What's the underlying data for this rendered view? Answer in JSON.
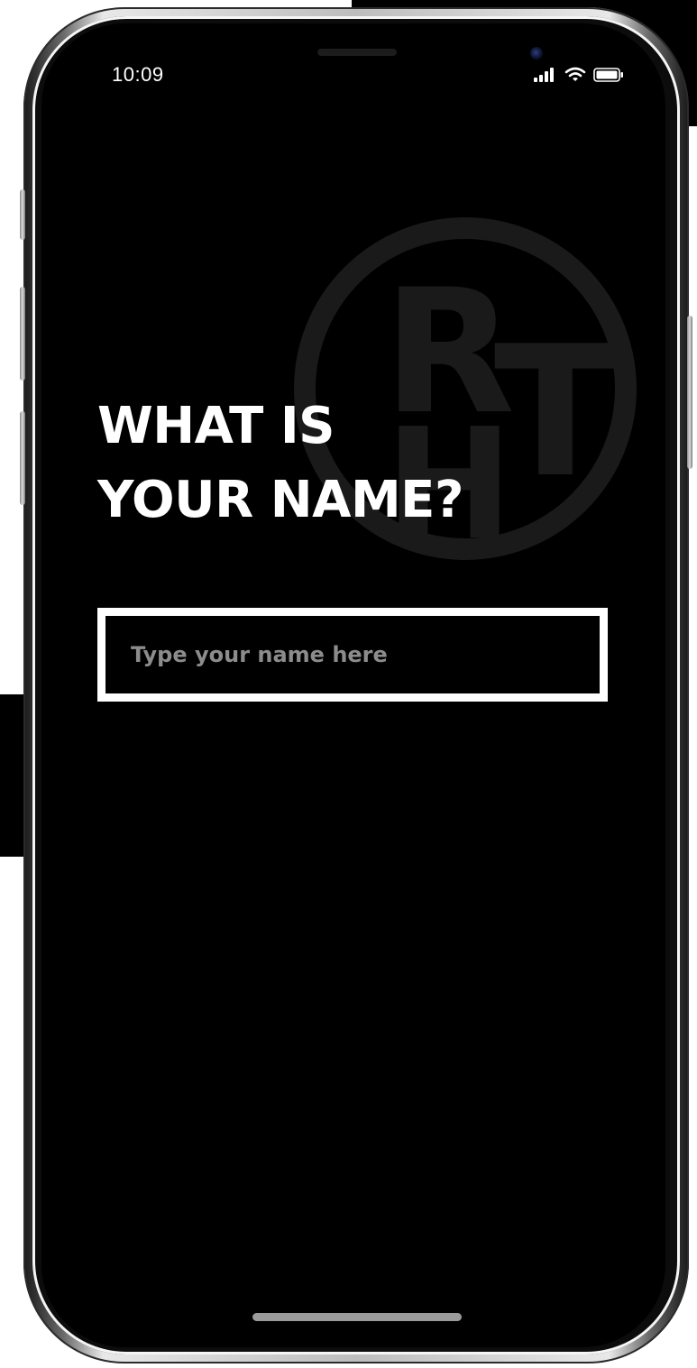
{
  "status_bar": {
    "time": "10:09",
    "icons": [
      "cellular-signal-icon",
      "wifi-icon",
      "battery-icon"
    ]
  },
  "logo": {
    "text": "RHT",
    "color": "#1a1a1a"
  },
  "prompt": {
    "line1": "WHAT IS",
    "line2": "YOUR NAME?"
  },
  "name_input": {
    "placeholder": "Type your name here",
    "value": ""
  },
  "colors": {
    "background": "#000000",
    "text": "#ffffff",
    "placeholder": "#8c8c8c",
    "input_border": "#ffffff"
  }
}
